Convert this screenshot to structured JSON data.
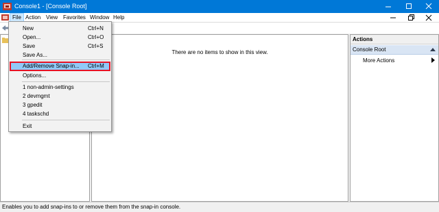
{
  "window": {
    "title": "Console1 - [Console Root]"
  },
  "menubar": {
    "items": [
      "File",
      "Action",
      "View",
      "Favorites",
      "Window",
      "Help"
    ]
  },
  "file_menu": {
    "items": [
      {
        "label": "New",
        "shortcut": "Ctrl+N"
      },
      {
        "label": "Open...",
        "shortcut": "Ctrl+O"
      },
      {
        "label": "Save",
        "shortcut": "Ctrl+S"
      },
      {
        "label": "Save As...",
        "shortcut": ""
      },
      {
        "label": "Add/Remove Snap-in...",
        "shortcut": "Ctrl+M",
        "highlighted": true
      },
      {
        "label": "Options...",
        "shortcut": ""
      },
      {
        "label": "1 non-admin-settings",
        "shortcut": ""
      },
      {
        "label": "2 devmgmt",
        "shortcut": ""
      },
      {
        "label": "3 gpedit",
        "shortcut": ""
      },
      {
        "label": "4 taskschd",
        "shortcut": ""
      },
      {
        "label": "Exit",
        "shortcut": ""
      }
    ]
  },
  "center": {
    "empty_text": "There are no items to show in this view."
  },
  "actions": {
    "header": "Actions",
    "group": "Console Root",
    "more": "More Actions"
  },
  "status": {
    "text": "Enables you to add snap-ins to or remove them from the snap-in console."
  },
  "colors": {
    "titlebar": "#0078d7",
    "highlight": "#91c9f7",
    "highlight_border": "#e81123",
    "actions_group": "#d9e5f4"
  }
}
